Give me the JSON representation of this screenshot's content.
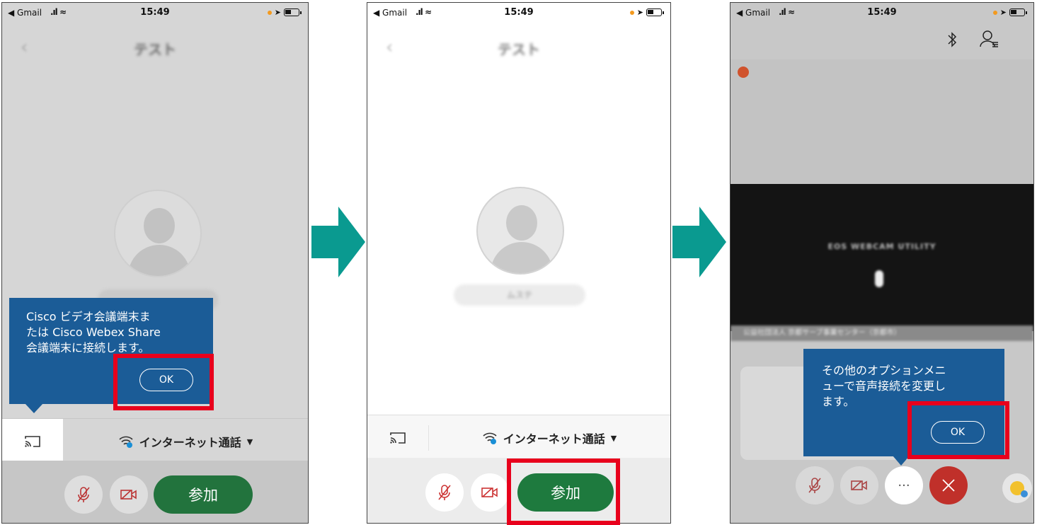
{
  "status": {
    "carrier": "◀ Gmail",
    "time": "15:49"
  },
  "screen1": {
    "title": "テスト",
    "tooltip_text": "Cisco ビデオ会議端末またはCisco Webex Share会議端末に接続します。",
    "tooltip_line1": "Cisco ビデオ会議端末ま",
    "tooltip_line2": "たは Cisco Webex Share",
    "tooltip_line3": "会議端末に接続します。",
    "ok_label": "OK",
    "audio_label": "インターネット通話",
    "join_label": "参加"
  },
  "screen2": {
    "title": "テスト",
    "name_pill": "ムステ",
    "audio_label": "インターネット通話",
    "join_label": "参加"
  },
  "screen3": {
    "video_caption": "EOS WEBCAM UTILITY",
    "name_bar": "公益社団法人 京都サーブ事業センター（京都市）",
    "tooltip_line1": "その他のオプションメニ",
    "tooltip_line2": "ューで音声接続を変更し",
    "tooltip_line3": "ます。",
    "ok_label": "OK",
    "more_label": "···"
  },
  "colors": {
    "accent_green": "#1e7a3e",
    "tooltip_blue": "#1b5c97",
    "highlight_red": "#e8001c",
    "arrow_teal": "#0a9a90",
    "leave_red": "#c0302a"
  }
}
